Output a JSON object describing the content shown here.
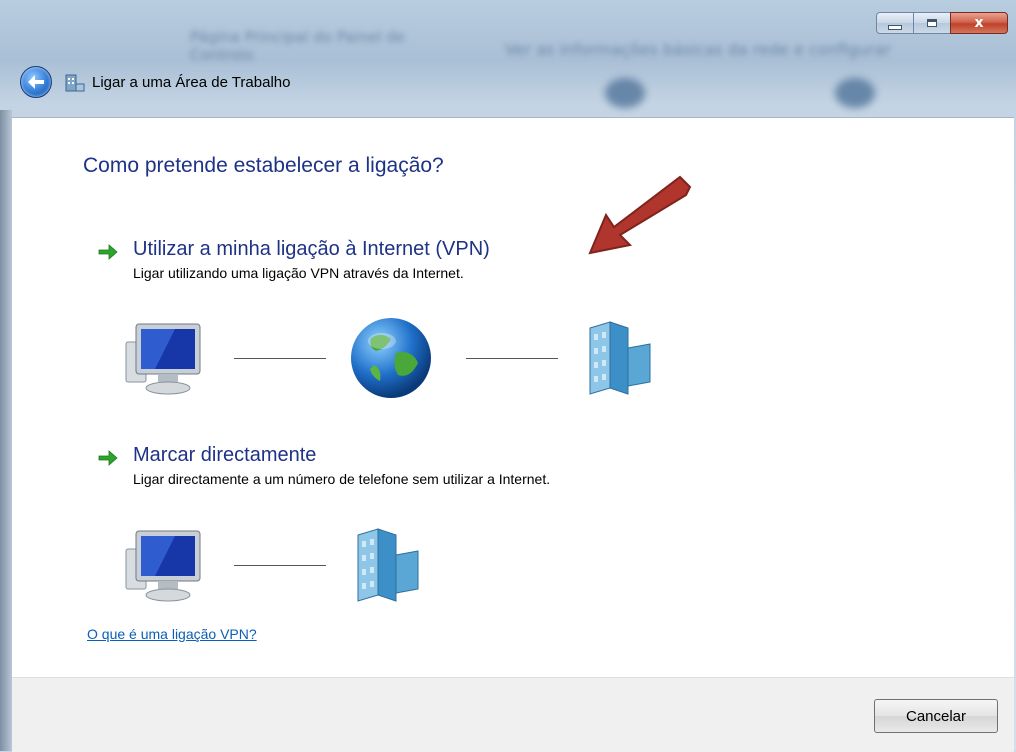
{
  "window": {
    "title": "Ligar a uma Área de Trabalho",
    "close_label": "x",
    "background_text_1": "Página Principal do Painel de Controlo",
    "background_text_2": "Ver as informações básicas da rede e configurar"
  },
  "main": {
    "heading": "Como pretende estabelecer a ligação?",
    "options": [
      {
        "title": "Utilizar a minha ligação à Internet (VPN)",
        "description": "Ligar utilizando uma ligação VPN através da Internet.",
        "diagram": [
          "computer-icon",
          "globe-icon",
          "server-building-icon"
        ]
      },
      {
        "title": "Marcar directamente",
        "description": "Ligar directamente a um número de telefone sem utilizar a Internet.",
        "diagram": [
          "computer-icon",
          "server-building-icon"
        ]
      }
    ],
    "help_link": "O que é uma ligação VPN?"
  },
  "footer": {
    "cancel_label": "Cancelar"
  },
  "colors": {
    "heading": "#1e3287",
    "link": "#0b5fb5",
    "option_arrow": "#2ea32e",
    "annotation_arrow": "#b0352c"
  }
}
